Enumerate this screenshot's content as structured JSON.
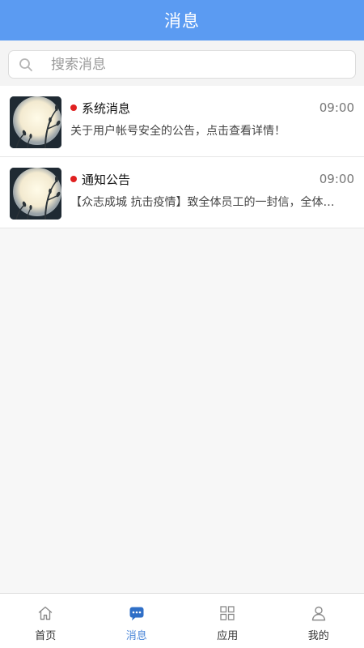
{
  "header": {
    "title": "消息"
  },
  "search": {
    "placeholder": "搜索消息"
  },
  "messages": [
    {
      "title": "系统消息",
      "time": "09:00",
      "preview": "关于用户帐号安全的公告，点击查看详情！",
      "unread": true
    },
    {
      "title": "通知公告",
      "time": "09:00",
      "preview": "【众志成城 抗击疫情】致全体员工的一封信，全体…",
      "unread": true
    }
  ],
  "tabbar": {
    "items": [
      {
        "label": "首页",
        "icon": "home-icon",
        "active": false
      },
      {
        "label": "消息",
        "icon": "message-icon",
        "active": true
      },
      {
        "label": "应用",
        "icon": "grid-icon",
        "active": false
      },
      {
        "label": "我的",
        "icon": "user-icon",
        "active": false
      }
    ]
  },
  "colors": {
    "header_bg": "#5b9bf2",
    "active_tab": "#4a86d8",
    "unread_dot": "#e02020"
  }
}
